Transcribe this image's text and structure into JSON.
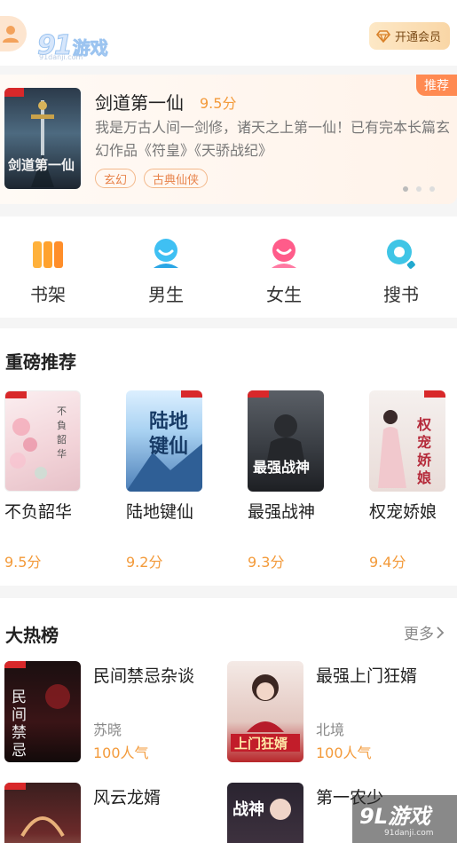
{
  "header": {
    "logo_number": "91",
    "logo_text": "游戏",
    "logo_sub": "91danji.com",
    "vip_label": "开通会员"
  },
  "banner": {
    "badge": "推荐",
    "title": "剑道第一仙",
    "score": "9.5分",
    "description": "我是万古人间一剑修，诸天之上第一仙！已有完本长篇玄幻作品《符皇》《天骄战纪》",
    "tags": [
      "玄幻",
      "古典仙侠"
    ],
    "cover_text": "剑道第一仙",
    "slide_count": 3,
    "active_slide": 0
  },
  "nav": [
    {
      "label": "书架",
      "icon": "bookshelf-icon"
    },
    {
      "label": "男生",
      "icon": "male-icon"
    },
    {
      "label": "女生",
      "icon": "female-icon"
    },
    {
      "label": "搜书",
      "icon": "search-book-icon"
    }
  ],
  "featured": {
    "title": "重磅推荐",
    "books": [
      {
        "name": "不负韶华",
        "score": "9.5分"
      },
      {
        "name": "陆地键仙",
        "score": "9.2分"
      },
      {
        "name": "最强战神",
        "score": "9.3分"
      },
      {
        "name": "权宠娇娘",
        "score": "9.4分"
      }
    ]
  },
  "hot": {
    "title": "大热榜",
    "more_label": "更多",
    "books": [
      {
        "name": "民间禁忌杂谈",
        "author": "苏晓",
        "popularity": "100人气"
      },
      {
        "name": "最强上门狂婿",
        "author": "北境",
        "popularity": "100人气"
      },
      {
        "name": "风云龙婿",
        "author": "",
        "popularity": ""
      },
      {
        "name": "第一农少",
        "author": "",
        "popularity": ""
      }
    ]
  },
  "colors": {
    "accent_orange": "#f39a3a",
    "badge_orange": "#ff8a52"
  },
  "watermark": {
    "main": "9L游戏",
    "sub": "91danji.com"
  }
}
